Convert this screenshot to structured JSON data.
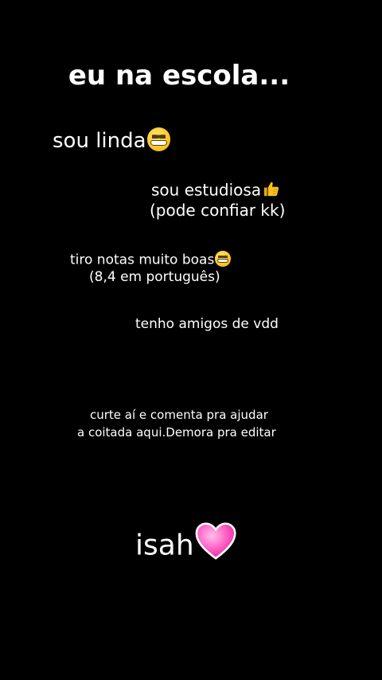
{
  "title": "eu na escola...",
  "lines": [
    {
      "text": "sou linda",
      "emoji": "grinning-face-icon"
    },
    {
      "text": "sou estudiosa",
      "emoji": "thumbs-up-icon"
    },
    {
      "text": "(pode confiar kk)"
    },
    {
      "text": "tiro notas muito boas",
      "emoji": "grinning-face-icon"
    },
    {
      "text": "(8,4 em português)"
    },
    {
      "text": "tenho amigos de vdd"
    },
    {
      "text": "curte aí e comenta pra ajudar"
    },
    {
      "text": "a coitada aqui.Demora pra editar"
    }
  ],
  "signature": {
    "text": "isah",
    "emoji": "pink-heart-icon"
  },
  "colors": {
    "background": "#000000",
    "text": "#ffffff",
    "emoji_yellow": "#f8c21b",
    "heart_pink": "#ff5fc4"
  }
}
